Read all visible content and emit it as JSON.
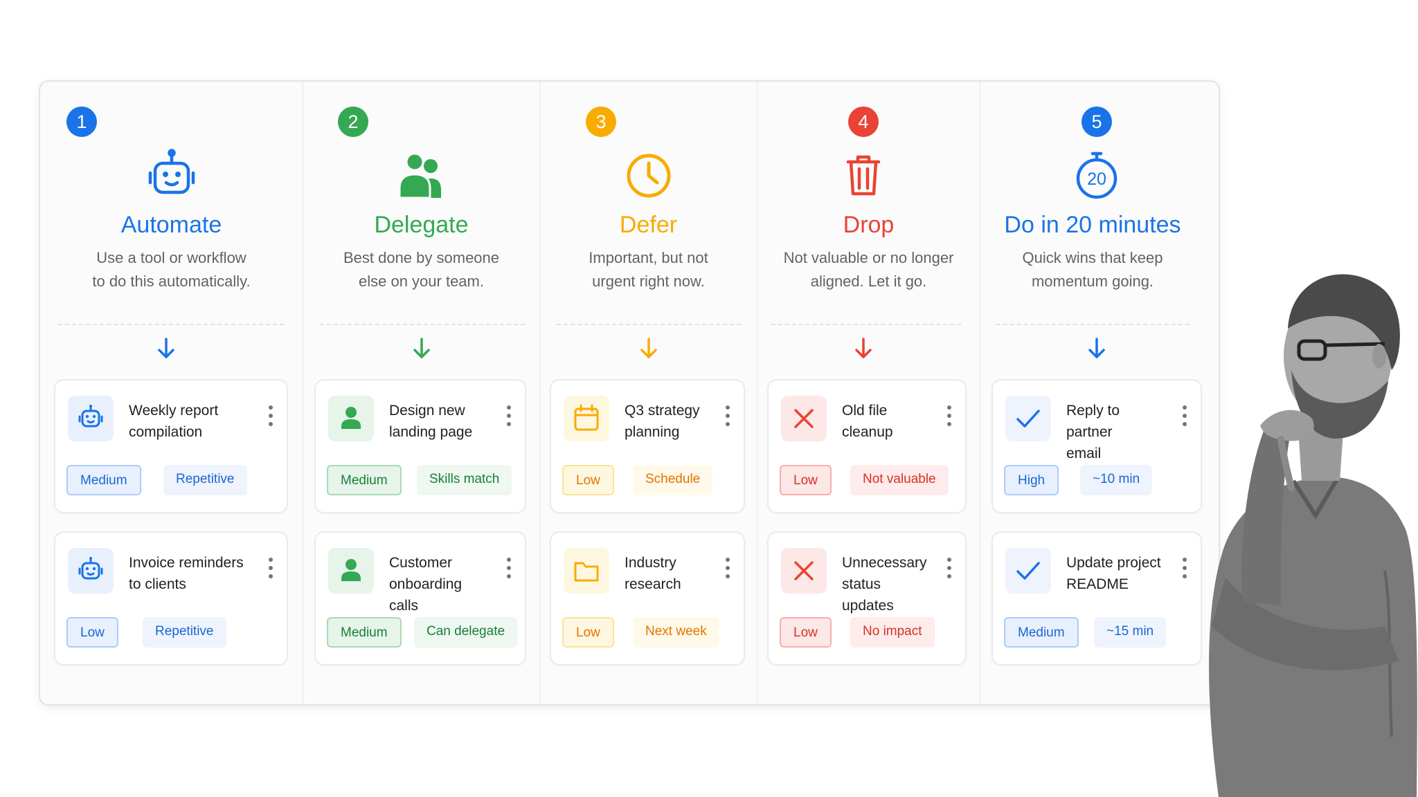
{
  "columns": [
    {
      "number": "1",
      "title": "Automate",
      "desc_line1": "Use a tool or workflow",
      "desc_line2": "to do this automatically.",
      "icon": "robot-icon",
      "color": "#1a73e8",
      "cards": [
        {
          "title_line1": "Weekly report",
          "title_line2": "compilation",
          "priority": "Medium",
          "tag": "Repetitive",
          "icon": "robot-icon"
        },
        {
          "title_line1": "Invoice reminders",
          "title_line2": "to clients",
          "priority": "Low",
          "tag": "Repetitive",
          "icon": "robot-icon"
        }
      ]
    },
    {
      "number": "2",
      "title": "Delegate",
      "desc_line1": "Best done by someone",
      "desc_line2": "else on your team.",
      "icon": "people-icon",
      "color": "#34a853",
      "cards": [
        {
          "title_line1": "Design new",
          "title_line2": "landing page",
          "priority": "Medium",
          "tag": "Skills match",
          "icon": "person-icon"
        },
        {
          "title_line1": "Customer",
          "title_line2": "onboarding calls",
          "priority": "Medium",
          "tag": "Can delegate",
          "icon": "person-icon"
        }
      ]
    },
    {
      "number": "3",
      "title": "Defer",
      "desc_line1": "Important, but not",
      "desc_line2": "urgent right now.",
      "icon": "clock-icon",
      "color": "#f9ab00",
      "cards": [
        {
          "title_line1": "Q3 strategy",
          "title_line2": "planning",
          "priority": "Low",
          "tag": "Schedule",
          "icon": "calendar-icon"
        },
        {
          "title_line1": "Industry",
          "title_line2": "research",
          "priority": "Low",
          "tag": "Next week",
          "icon": "folder-icon"
        }
      ]
    },
    {
      "number": "4",
      "title": "Drop",
      "desc_line1": "Not valuable or no longer",
      "desc_line2": "aligned. Let it go.",
      "icon": "trash-icon",
      "color": "#ea4335",
      "cards": [
        {
          "title_line1": "Old file",
          "title_line2": "cleanup",
          "priority": "Low",
          "tag": "Not valuable",
          "icon": "close-icon"
        },
        {
          "title_line1": "Unnecessary",
          "title_line2": "status updates",
          "priority": "Low",
          "tag": "No impact",
          "icon": "close-icon"
        }
      ]
    },
    {
      "number": "5",
      "title": "Do in 20 minutes",
      "desc_line1": "Quick wins that keep",
      "desc_line2": "momentum going.",
      "icon": "stopwatch-icon",
      "icon_text": "20",
      "color": "#1a73e8",
      "cards": [
        {
          "title_line1": "Reply to partner",
          "title_line2": "email",
          "priority": "High",
          "tag": "~10 min",
          "icon": "check-icon"
        },
        {
          "title_line1": "Update project",
          "title_line2": "README",
          "priority": "Medium",
          "tag": "~15 min",
          "icon": "check-icon"
        }
      ]
    }
  ]
}
